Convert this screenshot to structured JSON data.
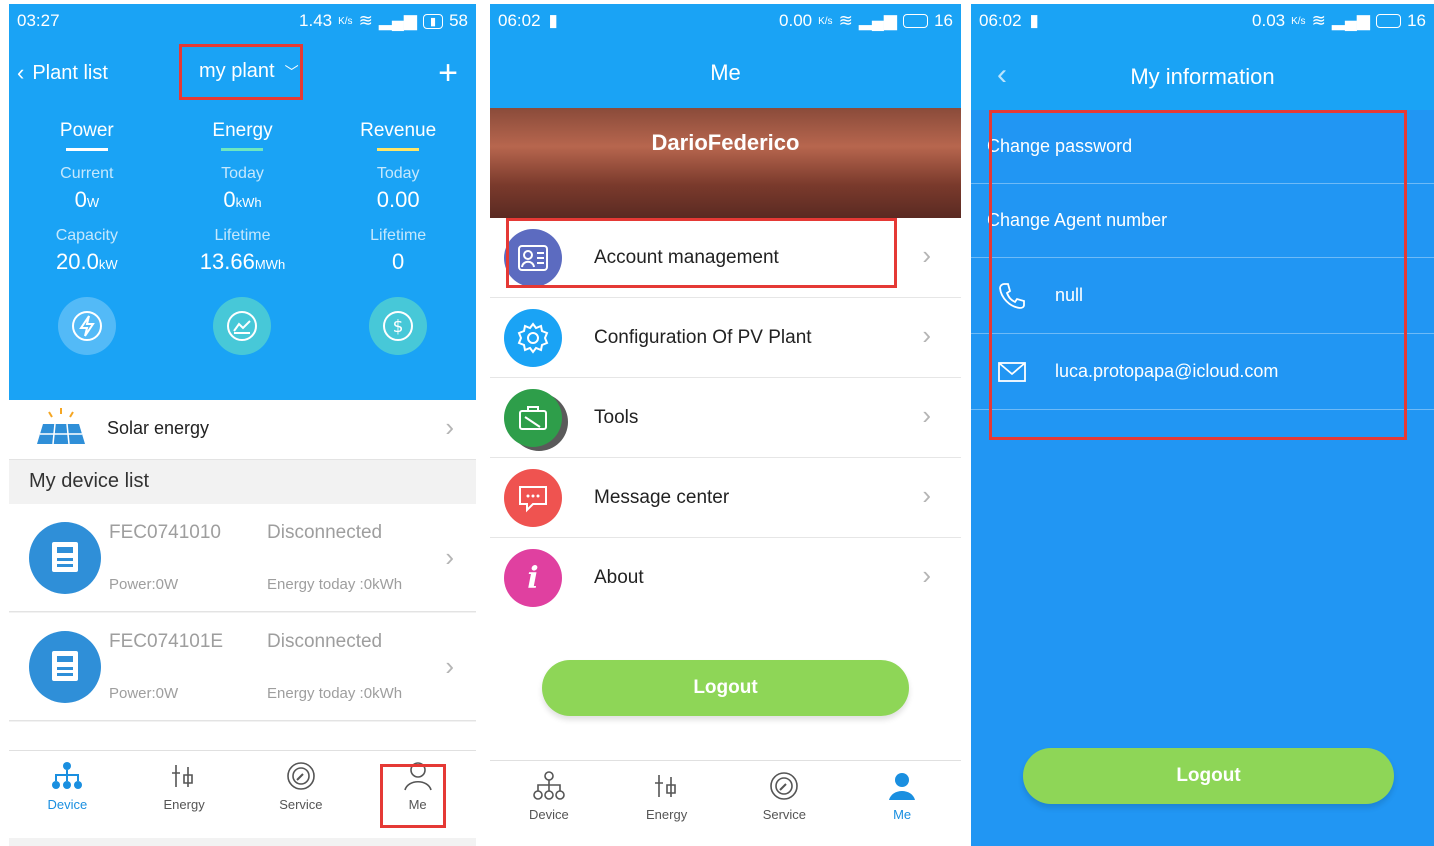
{
  "screen1": {
    "status": {
      "time": "03:27",
      "speed": "1.43",
      "speed_unit": "K/s",
      "battery": "58"
    },
    "nav": {
      "back_label": "Plant list",
      "title": "my plant",
      "add_icon": "plus-icon"
    },
    "stats": {
      "columns": [
        {
          "header": "Power",
          "label1": "Current",
          "value1": "0",
          "unit1": "W",
          "label2": "Capacity",
          "value2": "20.0",
          "unit2": "kW",
          "underline": "#ffffff"
        },
        {
          "header": "Energy",
          "label1": "Today",
          "value1": "0",
          "unit1": "kWh",
          "label2": "Lifetime",
          "value2": "13.66",
          "unit2": "MWh",
          "underline": "#6ee7c0"
        },
        {
          "header": "Revenue",
          "label1": "Today",
          "value1": "0.00",
          "unit1": "",
          "label2": "Lifetime",
          "value2": "0",
          "unit2": "",
          "underline": "#ffe566"
        }
      ]
    },
    "solar_label": "Solar energy",
    "device_list_title": "My device list",
    "devices": [
      {
        "id": "FEC0741010",
        "status": "Disconnected",
        "power": "Power:0W",
        "energy": "Energy today :0kWh"
      },
      {
        "id": "FEC074101E",
        "status": "Disconnected",
        "power": "Power:0W",
        "energy": "Energy today :0kWh"
      }
    ],
    "tabs": [
      "Device",
      "Energy",
      "Service",
      "Me"
    ]
  },
  "screen2": {
    "status": {
      "time": "06:02",
      "speed": "0.00",
      "speed_unit": "K/s",
      "battery": "16"
    },
    "title": "Me",
    "username": "DarioFederico",
    "menu": [
      {
        "label": "Account management",
        "icon": "account-card-icon",
        "color": "#5c6bc0"
      },
      {
        "label": "Configuration Of PV Plant",
        "icon": "gear-icon",
        "color": "#1aa3f5"
      },
      {
        "label": "Tools",
        "icon": "toolbox-icon",
        "color": "#2e9e4a"
      },
      {
        "label": "Message center",
        "icon": "message-icon",
        "color": "#ef5350"
      },
      {
        "label": "About",
        "icon": "info-icon",
        "color": "#e040a0"
      }
    ],
    "logout": "Logout",
    "tabs": [
      "Device",
      "Energy",
      "Service",
      "Me"
    ]
  },
  "screen3": {
    "status": {
      "time": "06:02",
      "speed": "0.03",
      "speed_unit": "K/s",
      "battery": "16"
    },
    "title": "My information",
    "rows": {
      "change_password": "Change password",
      "change_agent": "Change Agent number",
      "phone": "null",
      "email": "luca.protopapa@icloud.com"
    },
    "logout": "Logout"
  }
}
